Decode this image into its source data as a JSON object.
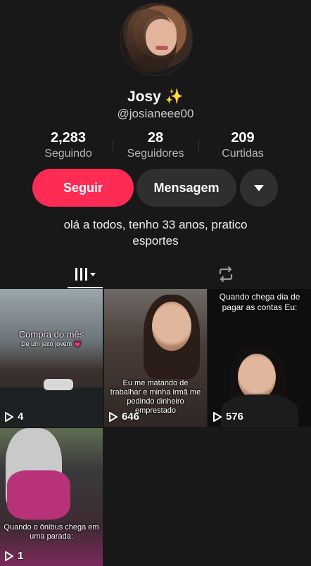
{
  "profile": {
    "display_name": "Josy",
    "name_emoji": "✨",
    "handle": "@josianeee00",
    "bio": "olá a todos, tenho 33 anos, pratico esportes"
  },
  "stats": [
    {
      "value": "2,283",
      "label": "Seguindo"
    },
    {
      "value": "28",
      "label": "Seguidores"
    },
    {
      "value": "209",
      "label": "Curtidas"
    }
  ],
  "actions": {
    "follow_label": "Seguir",
    "message_label": "Mensagem",
    "follow_color": "#fe2c55"
  },
  "tabs": [
    {
      "name": "videos",
      "icon": "grid-icon",
      "active": true
    },
    {
      "name": "reposts",
      "icon": "repost-icon",
      "active": false
    }
  ],
  "videos": [
    {
      "caption": "Compra do mês",
      "subcaption": "De um jeito jovem 💗",
      "views": "4"
    },
    {
      "caption": "Eu me matando de trabalhar e minha irmã me pedindo dinheiro emprestado",
      "views": "646"
    },
    {
      "caption": "Quando chega dia de pagar as contas Eu:",
      "views": "576"
    },
    {
      "caption": "Quando o ônibus chega em uma parada:",
      "views": "1"
    }
  ]
}
